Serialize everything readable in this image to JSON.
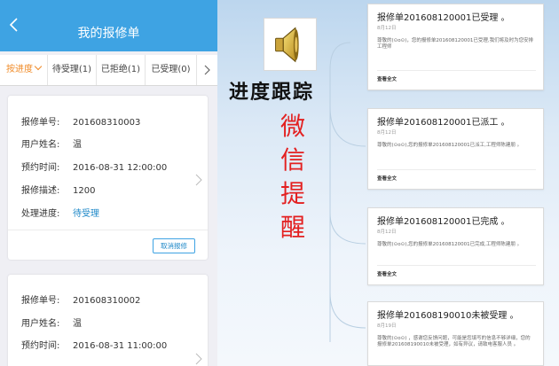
{
  "phone": {
    "title": "我的报修单",
    "tabs": [
      {
        "label": "按进度",
        "active": true
      },
      {
        "label": "待受理(1)"
      },
      {
        "label": "已拒绝(1)"
      },
      {
        "label": "已受理(0)"
      }
    ],
    "cards": [
      {
        "fields": [
          {
            "key": "报修单号:",
            "value": "201608310003"
          },
          {
            "key": "用户姓名:",
            "value": "温"
          },
          {
            "key": "预约时间:",
            "value": "2016-08-31 12:00:00"
          },
          {
            "key": "报修描述:",
            "value": "1200"
          },
          {
            "key": "处理进度:",
            "value": "待受理"
          }
        ],
        "action_label": "取消报修"
      },
      {
        "fields": [
          {
            "key": "报修单号:",
            "value": "201608310002"
          },
          {
            "key": "用户姓名:",
            "value": "温"
          },
          {
            "key": "预约时间:",
            "value": "2016-08-31 11:00:00"
          }
        ]
      }
    ],
    "accent_color": "#3ea3e3",
    "status_color": "#1e88c8",
    "active_tab_color": "#f08a26"
  },
  "middle": {
    "icon": "speaker-icon",
    "title": "进度跟踪",
    "vertical_text": [
      "微",
      "信",
      "提",
      "醒"
    ],
    "vertical_color": "#e32020"
  },
  "notices": [
    {
      "title": "报修单201608120001已受理 。",
      "date": "8月12日",
      "body": "尊敬的(⊙o⊙)，您的报修单201608120001已受理,我们将及时为您安排工程师",
      "link": "查看全文"
    },
    {
      "title": "报修单201608120001已派工 。",
      "date": "8月12日",
      "body": "尊敬的(⊙o⊙),您的报修单201608120001已派工,工程师陈建朋 。",
      "link": "查看全文"
    },
    {
      "title": "报修单201608120001已完成 。",
      "date": "8月12日",
      "body": "尊敬的(⊙o⊙),您的报修单201608120001已完成,工程师陈建朋 。",
      "link": "查看全文"
    },
    {
      "title": "报修单201608190010未被受理 。",
      "date": "8月19日",
      "body": "尊敬的(⊙o⊙) ，感谢您反馈问题，可能是您填写的信息不够详细，您的报修单201608190010未被受理，如有异议，请致电客服人员 。"
    }
  ]
}
